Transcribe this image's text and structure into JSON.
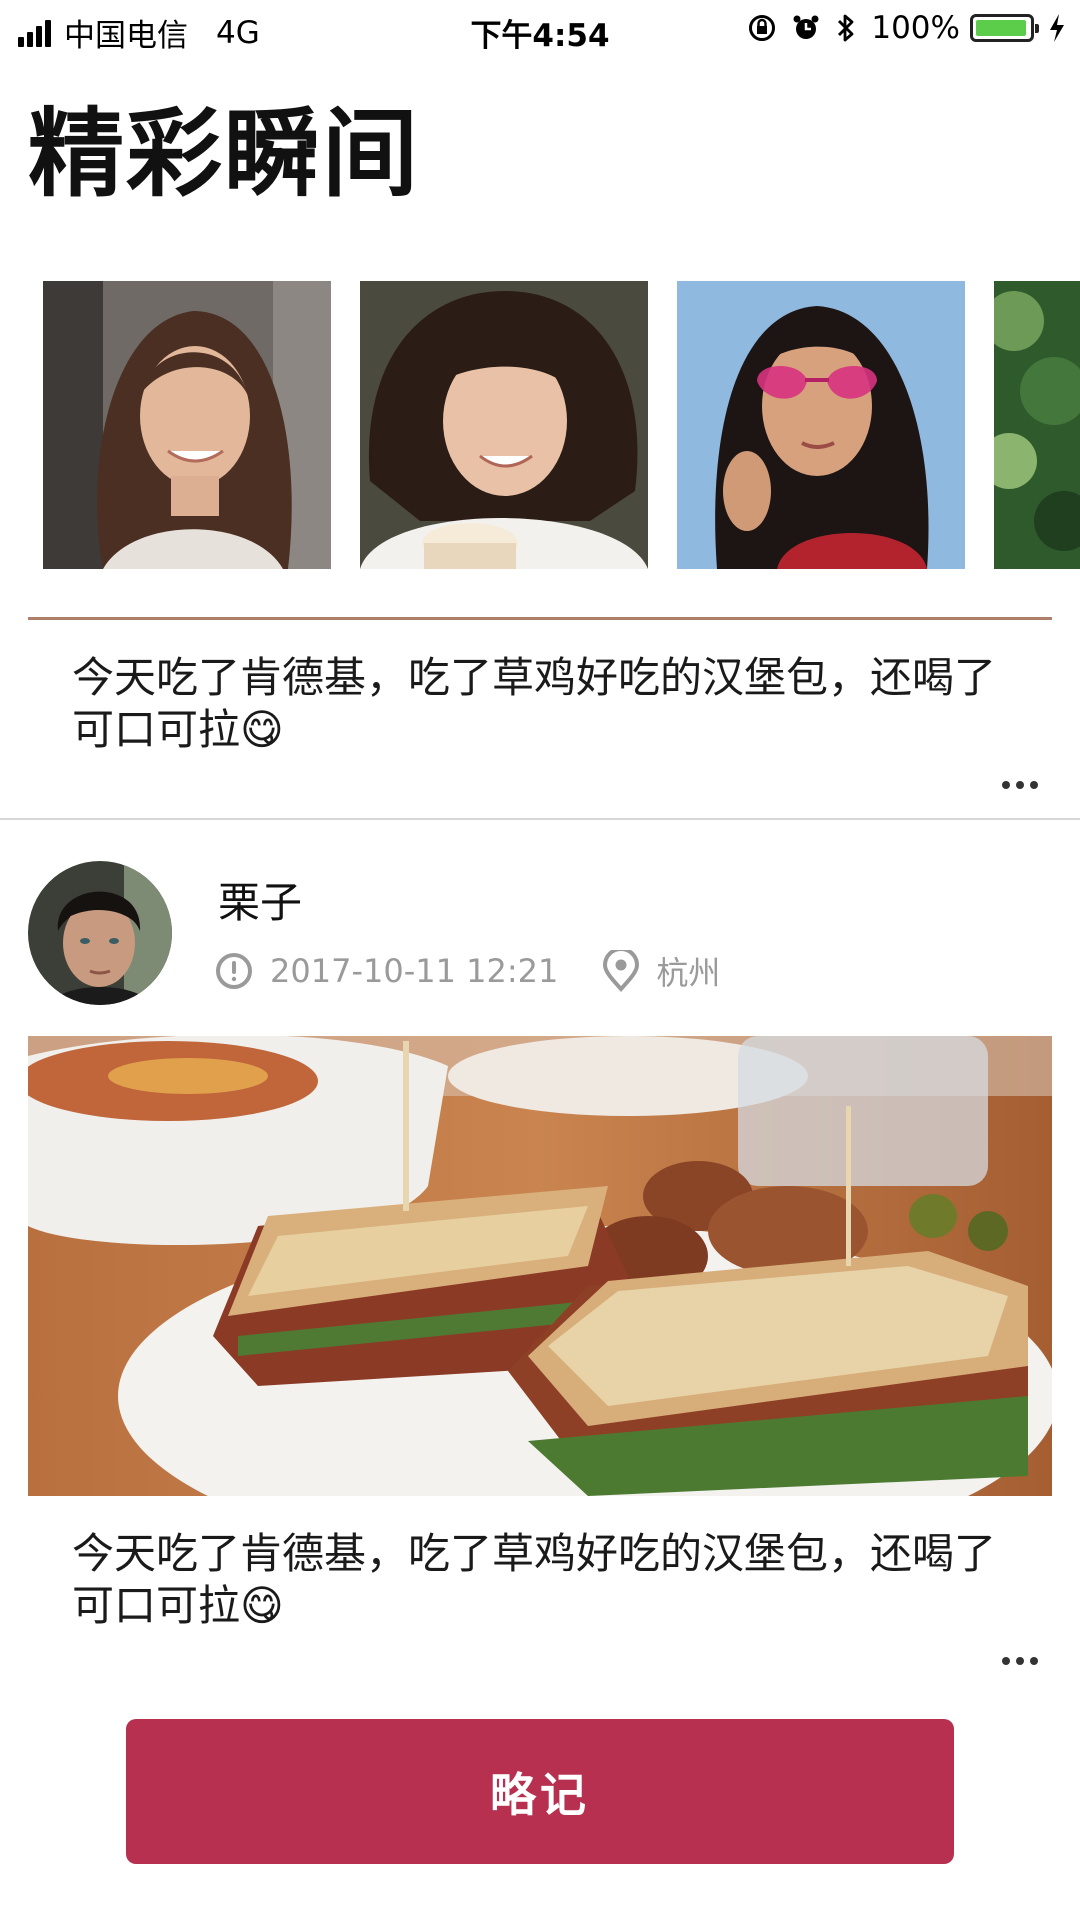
{
  "status_bar": {
    "carrier": "中国电信",
    "network": "4G",
    "time": "下午4:54",
    "battery_percent": "100%",
    "battery_level": 1.0,
    "icons": [
      "signal-bars-icon",
      "orientation-lock-icon",
      "alarm-icon",
      "bluetooth-icon",
      "battery-icon",
      "charging-bolt-icon"
    ]
  },
  "page": {
    "title": "精彩瞬间"
  },
  "moments": {
    "items": [
      {
        "kind": "photo",
        "subject": "smiling woman with long brown hair"
      },
      {
        "kind": "photo",
        "subject": "curly-haired woman holding a coffee cup"
      },
      {
        "kind": "photo",
        "subject": "woman wearing pink heart-shaped sunglasses"
      },
      {
        "kind": "photo",
        "subject": "green foliage (partially visible)"
      }
    ]
  },
  "first_post": {
    "text": "今天吃了肯德基，吃了草鸡好吃的汉堡包，还喝了可口可拉😋",
    "more_icon": "more-horizontal-icon"
  },
  "second_post": {
    "author": "栗子",
    "timestamp": "2017-10-11 12:21",
    "location": "杭州",
    "time_icon": "clock-icon",
    "location_icon": "location-pin-icon",
    "photo_subject": "toasted sandwiches on a white plate",
    "text": "今天吃了肯德基，吃了草鸡好吃的汉堡包，还喝了可口可拉😋",
    "more_icon": "more-horizontal-icon"
  },
  "action_button": {
    "label": "略记"
  },
  "colors": {
    "accent": "#b8304f",
    "meta_text": "#9a9a9a",
    "divider": "#d7d7d7",
    "battery": "#5ccd4a"
  }
}
